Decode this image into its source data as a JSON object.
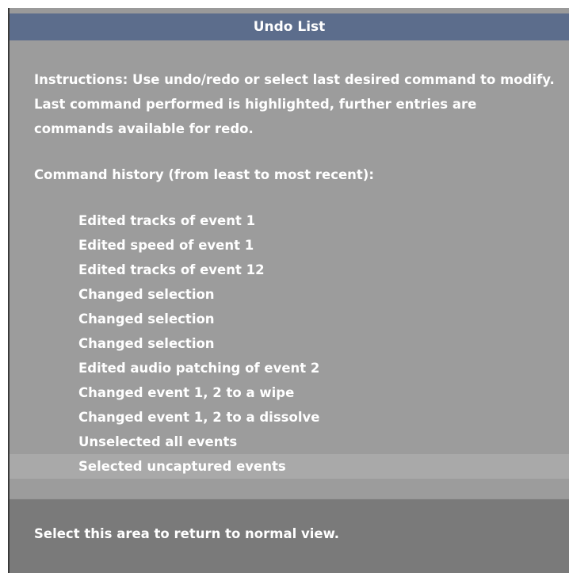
{
  "window": {
    "title": "Undo List"
  },
  "instructions": {
    "text": "Instructions: Use undo/redo or select last desired command to modify. Last command performed is highlighted, further entries are commands available for redo."
  },
  "history": {
    "heading": "Command history (from least to most recent):",
    "items": [
      {
        "label": "Edited tracks of event 1"
      },
      {
        "label": "Edited speed of event 1"
      },
      {
        "label": "Edited tracks of event 12"
      },
      {
        "label": "Changed selection"
      },
      {
        "label": "Changed selection"
      },
      {
        "label": "Changed selection"
      },
      {
        "label": "Edited audio patching of event 2"
      },
      {
        "label": "Changed event 1, 2 to a wipe"
      },
      {
        "label": "Changed event 1, 2 to a dissolve"
      },
      {
        "label": "Unselected all events"
      },
      {
        "label": "Selected uncaptured events"
      }
    ]
  },
  "footer": {
    "return_label": "Select this area to return to normal view."
  },
  "colors": {
    "titlebar": "#5c6d8c",
    "panel": "#9c9c9c",
    "highlight": "#a9a9a9",
    "footer": "#7a7a7a",
    "text": "#ffffff"
  }
}
